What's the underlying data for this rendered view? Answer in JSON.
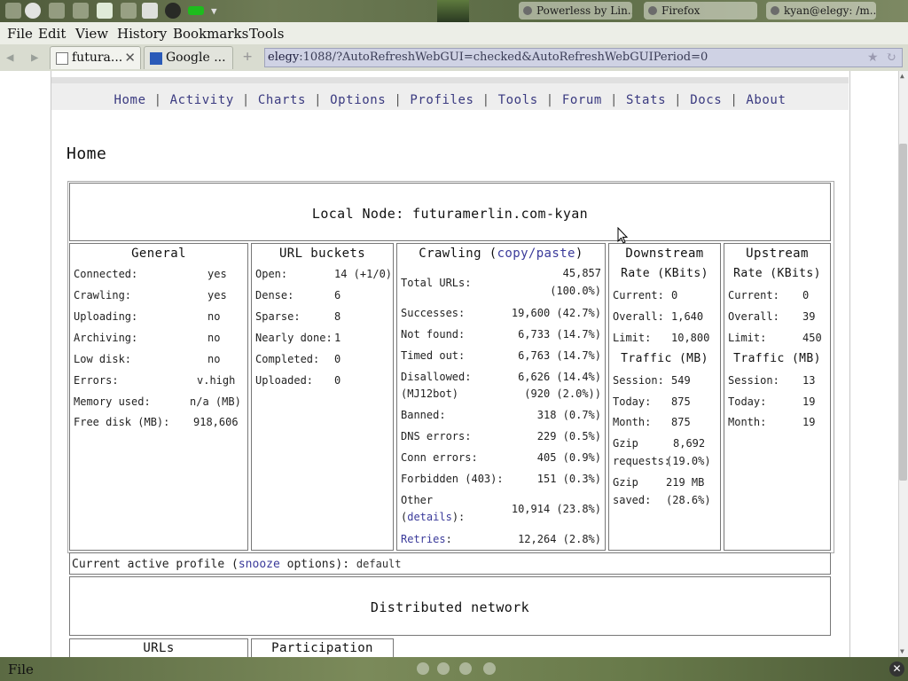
{
  "system_panel": {
    "windows": [
      "Powerless by Lin...",
      "Firefox",
      "kyan@elegy: /m..."
    ]
  },
  "menubar": [
    "File",
    "Edit",
    "View",
    "History",
    "Bookmarks",
    "Tools"
  ],
  "tabs": [
    {
      "label": "futura..."
    },
    {
      "label": "Google ..."
    }
  ],
  "url": {
    "host": "elegy",
    "rest": ":1088/?AutoRefreshWebGUI=checked&AutoRefreshWebGUIPeriod=0"
  },
  "nav": [
    "Home",
    "Activity",
    "Charts",
    "Options",
    "Profiles",
    "Tools",
    "Forum",
    "Stats",
    "Docs",
    "About"
  ],
  "page_title": "Home",
  "local_node": "Local Node: futuramerlin.com-kyan",
  "general": {
    "title": "General",
    "rows": [
      {
        "label": "Connected:",
        "value": "yes"
      },
      {
        "label": "Crawling:",
        "value": "yes"
      },
      {
        "label": "Uploading:",
        "value": "no"
      },
      {
        "label": "Archiving:",
        "value": "no"
      },
      {
        "label": "Low disk:",
        "value": "no"
      },
      {
        "label": "Errors:",
        "value": "v.high"
      },
      {
        "label": "Memory used:",
        "value": "n/a (MB)"
      },
      {
        "label": "Free disk (MB):",
        "value": "918,606"
      }
    ]
  },
  "buckets": {
    "title": "URL buckets",
    "rows": [
      {
        "label": "Open:",
        "value": "14 (+1/0)"
      },
      {
        "label": "Dense:",
        "value": "6"
      },
      {
        "label": "Sparse:",
        "value": "8"
      },
      {
        "label": "Nearly done:",
        "value": "1"
      },
      {
        "label": "Completed:",
        "value": "0"
      },
      {
        "label": "Uploaded:",
        "value": "0"
      }
    ]
  },
  "crawling": {
    "title_pre": "Crawling (",
    "title_link": "copy/paste",
    "title_post": ")",
    "total_label": "Total URLs:",
    "total_value": "45,857",
    "total_pct": "(100.0%)",
    "successes_label": "Successes:",
    "successes_value": "19,600 (42.7%)",
    "notfound_label": "Not found:",
    "notfound_value": "6,733 (14.7%)",
    "timedout_label": "Timed out:",
    "timedout_value": "6,763 (14.7%)",
    "disallowed_label": "Disallowed:",
    "disallowed_value": "6,626 (14.4%)",
    "mj12_label": "(MJ12bot)",
    "mj12_value": "(920 (2.0%))",
    "banned_label": "Banned:",
    "banned_value": "318 (0.7%)",
    "dns_label": "DNS errors:",
    "dns_value": "229 (0.5%)",
    "conn_label": "Conn errors:",
    "conn_value": "405 (0.9%)",
    "forbidden_label": "Forbidden (403):",
    "forbidden_value": "151 (0.3%)",
    "other_label": "Other",
    "other_details_pre": "(",
    "other_details_link": "details",
    "other_details_post": "):",
    "other_value": "10,914 (23.8%)",
    "retries_link": "Retries",
    "retries_post": ":",
    "retries_value": "12,264 (2.8%)"
  },
  "downstream": {
    "title": "Downstream",
    "rate_header": "Rate (KBits)",
    "current_label": "Current:",
    "current_value": "0",
    "overall_label": "Overall:",
    "overall_value": "1,640",
    "limit_label": "Limit:",
    "limit_value": "10,800",
    "traffic_header": "Traffic (MB)",
    "session_label": "Session:",
    "session_value": "549",
    "today_label": "Today:",
    "today_value": "875",
    "month_label": "Month:",
    "month_value": "875",
    "gzipreq_label1": "Gzip",
    "gzipreq_label2": "requests:",
    "gzipreq_value1": "8,692",
    "gzipreq_value2": "(19.0%)",
    "gzipsaved_label1": "Gzip",
    "gzipsaved_label2": "saved:",
    "gzipsaved_value1": "219 MB",
    "gzipsaved_value2": "(28.6%)"
  },
  "upstream": {
    "title": "Upstream",
    "rate_header": "Rate (KBits)",
    "current_label": "Current:",
    "current_value": "0",
    "overall_label": "Overall:",
    "overall_value": "39",
    "limit_label": "Limit:",
    "limit_value": "450",
    "traffic_header": "Traffic (MB)",
    "session_label": "Session:",
    "session_value": "13",
    "today_label": "Today:",
    "today_value": "19",
    "month_label": "Month:",
    "month_value": "19"
  },
  "profile": {
    "pre": "Current active profile (",
    "link": "snooze",
    "post": " options):",
    "value": "default"
  },
  "distributed": {
    "title": "Distributed network",
    "col1": "URLs",
    "col2": "Participation"
  },
  "statusbar": {
    "label": "File"
  }
}
